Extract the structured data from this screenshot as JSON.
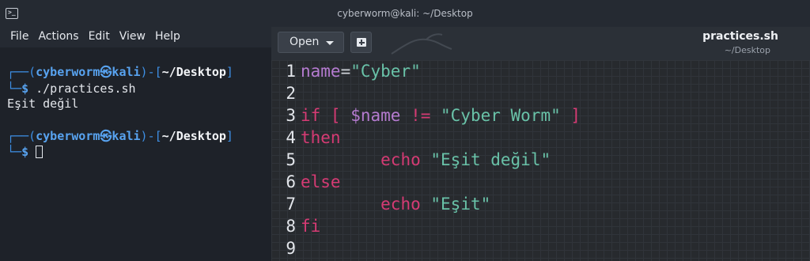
{
  "window": {
    "title": "cyberworm@kali: ~/Desktop"
  },
  "menu": {
    "items": [
      "File",
      "Actions",
      "Edit",
      "View",
      "Help"
    ]
  },
  "terminal": {
    "prompt1": {
      "corner": "┌──(",
      "user": "cyberworm",
      "at": "㉿",
      "host": "kali",
      "mid": ")-[",
      "dir": "~/Desktop",
      "end": "]"
    },
    "line2": {
      "corner": "└─",
      "dollar": "$",
      "command": " ./practices.sh"
    },
    "output": "Eşit değil",
    "prompt2": {
      "corner": "┌──(",
      "user": "cyberworm",
      "at": "㉿",
      "host": "kali",
      "mid": ")-[",
      "dir": "~/Desktop",
      "end": "]"
    },
    "line5": {
      "corner": "└─",
      "dollar": "$"
    }
  },
  "editor": {
    "open_label": "Open",
    "file_name": "practices.sh",
    "file_path": "~/Desktop",
    "line_numbers": [
      "1",
      "2",
      "3",
      "4",
      "5",
      "6",
      "7",
      "8",
      "9"
    ],
    "code": {
      "l1": {
        "var": "name",
        "eq": "=",
        "str": "\"Cyber\""
      },
      "l3": {
        "if": "if [ ",
        "var": "$name",
        "op": " != ",
        "str": "\"Cyber Worm\"",
        "close": " ]"
      },
      "l4": {
        "kw": "then"
      },
      "l5": {
        "indent": "        ",
        "cmd": "echo",
        "sp": " ",
        "str": "\"Eşit değil\""
      },
      "l6": {
        "kw": "else"
      },
      "l7": {
        "indent": "        ",
        "cmd": "echo",
        "sp": " ",
        "str": "\"Eşit\""
      },
      "l8": {
        "kw": "fi"
      }
    }
  }
}
